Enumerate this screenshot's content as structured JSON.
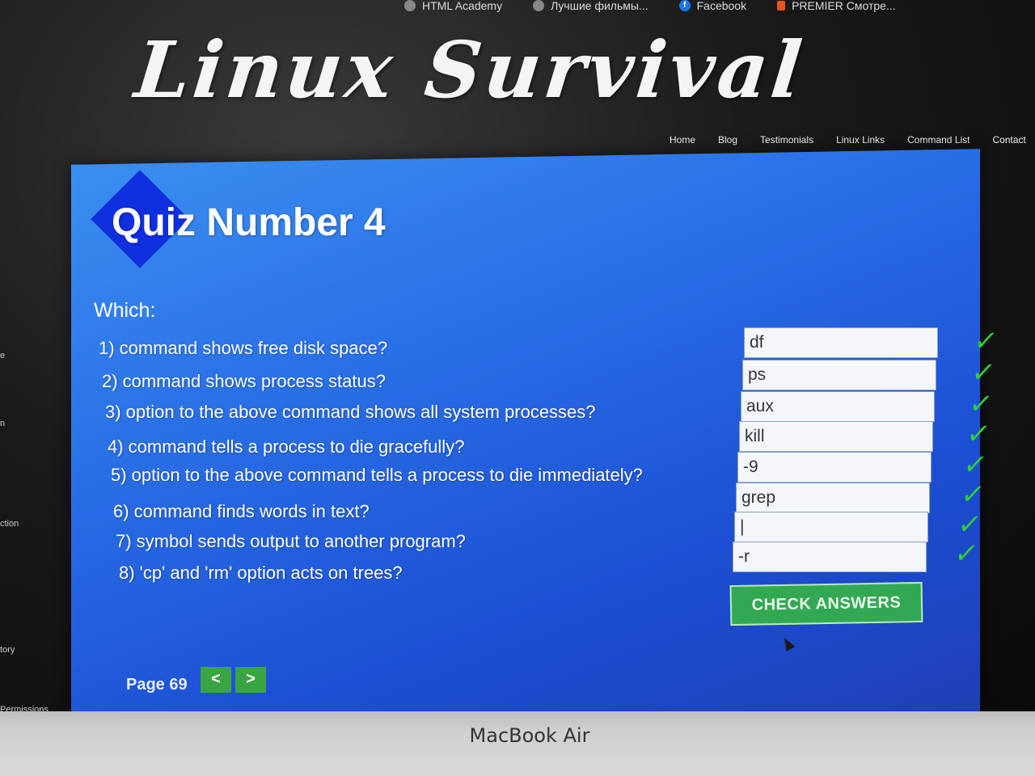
{
  "bookmarks": [
    {
      "label": "HTML Academy",
      "icon": "academy-icon"
    },
    {
      "label": "Лучшие фильмы...",
      "icon": "film-icon"
    },
    {
      "label": "Facebook",
      "icon": "facebook-icon"
    },
    {
      "label": "PREMIER Смотре...",
      "icon": "premier-icon"
    }
  ],
  "site": {
    "title": "Linux Survival"
  },
  "nav": [
    {
      "label": "Home"
    },
    {
      "label": "Blog"
    },
    {
      "label": "Testimonials"
    },
    {
      "label": "Linux Links"
    },
    {
      "label": "Command List"
    },
    {
      "label": "Contact"
    }
  ],
  "sidebar": [
    {
      "label": "e"
    },
    {
      "label": "n"
    },
    {
      "label": "ction"
    },
    {
      "label": "tory"
    },
    {
      "label": "Permissions"
    }
  ],
  "quiz": {
    "title": "Quiz Number 4",
    "prompt": "Which:",
    "questions": [
      {
        "text": "1) command shows free disk space?",
        "answer": "df"
      },
      {
        "text": "2) command shows process status?",
        "answer": "ps"
      },
      {
        "text": "3) option to the above command shows all system processes?",
        "answer": "aux"
      },
      {
        "text": "4) command tells a process to die gracefully?",
        "answer": "kill"
      },
      {
        "text": "5) option to the above command tells a process to die immediately?",
        "answer": "-9"
      },
      {
        "text": "6) command finds words in text?",
        "answer": "grep"
      },
      {
        "text": "7) symbol sends output to another program?",
        "answer": "|"
      },
      {
        "text": "8) 'cp' and 'rm' option acts on trees?",
        "answer": "-r"
      }
    ],
    "check_label": "CHECK ANSWERS",
    "check_mark": "✓"
  },
  "pager": {
    "label": "Page 69",
    "prev": "<",
    "next": ">"
  },
  "device": {
    "label": "MacBook Air"
  },
  "colors": {
    "panel": "#2a6fe6",
    "button_green": "#33a852",
    "check_green": "#2fcf3a",
    "diamond": "#1030e0"
  }
}
